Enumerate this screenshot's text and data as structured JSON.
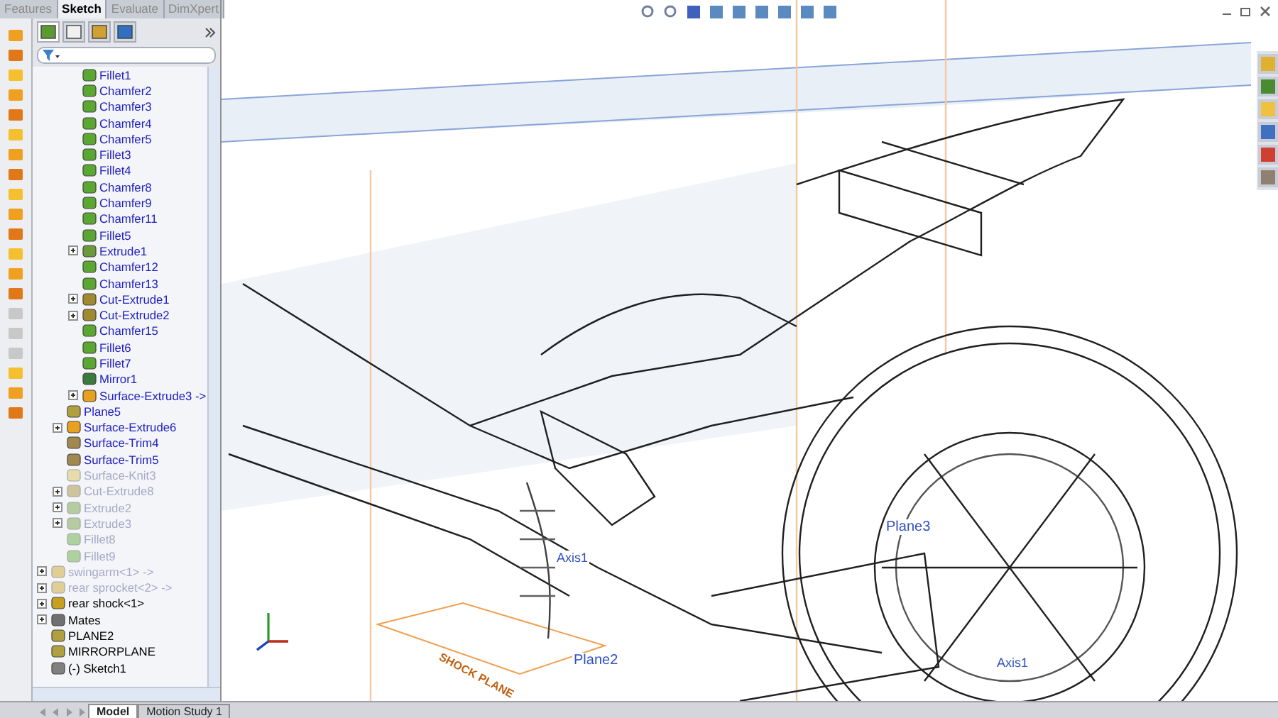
{
  "manager_tabs": [
    {
      "label": "Features",
      "selected": false
    },
    {
      "label": "Sketch",
      "selected": true
    },
    {
      "label": "Evaluate",
      "selected": false
    },
    {
      "label": "DimXpert",
      "selected": false
    }
  ],
  "command_icons": [
    {
      "disabled": false
    },
    {
      "disabled": false
    },
    {
      "disabled": false
    },
    {
      "disabled": false
    },
    {
      "disabled": false
    },
    {
      "disabled": false
    },
    {
      "disabled": false
    },
    {
      "disabled": false
    },
    {
      "disabled": false
    },
    {
      "disabled": false
    },
    {
      "disabled": false
    },
    {
      "disabled": false
    },
    {
      "disabled": false
    },
    {
      "disabled": false
    },
    {
      "disabled": true
    },
    {
      "disabled": true
    },
    {
      "disabled": true
    },
    {
      "disabled": false
    },
    {
      "disabled": false
    },
    {
      "disabled": false
    }
  ],
  "panel_tabs": [
    {
      "selected": true
    },
    {
      "selected": false
    },
    {
      "selected": false
    },
    {
      "selected": false
    }
  ],
  "tree": {
    "items": [
      {
        "children": [
          {
            "children": [
              {
                "label": "Fillet1",
                "kind": "fillet",
                "suppressed": false,
                "expandable": false
              },
              {
                "label": "Chamfer2",
                "kind": "fillet",
                "suppressed": false,
                "expandable": false
              },
              {
                "label": "Chamfer3",
                "kind": "fillet",
                "suppressed": false,
                "expandable": false
              },
              {
                "label": "Chamfer4",
                "kind": "fillet",
                "suppressed": false,
                "expandable": false
              },
              {
                "label": "Chamfer5",
                "kind": "fillet",
                "suppressed": false,
                "expandable": false
              },
              {
                "label": "Fillet3",
                "kind": "fillet",
                "suppressed": false,
                "expandable": false
              },
              {
                "label": "Fillet4",
                "kind": "fillet",
                "suppressed": false,
                "expandable": false
              },
              {
                "label": "Chamfer8",
                "kind": "fillet",
                "suppressed": false,
                "expandable": false
              },
              {
                "label": "Chamfer9",
                "kind": "fillet",
                "suppressed": false,
                "expandable": false
              },
              {
                "label": "Chamfer11",
                "kind": "fillet",
                "suppressed": false,
                "expandable": false
              },
              {
                "label": "Fillet5",
                "kind": "fillet",
                "suppressed": false,
                "expandable": false
              },
              {
                "label": "Extrude1",
                "kind": "extrude",
                "suppressed": false,
                "expandable": true
              },
              {
                "label": "Chamfer12",
                "kind": "fillet",
                "suppressed": false,
                "expandable": false
              },
              {
                "label": "Chamfer13",
                "kind": "fillet",
                "suppressed": false,
                "expandable": false
              },
              {
                "label": "Cut-Extrude1",
                "kind": "cut",
                "suppressed": false,
                "expandable": true
              },
              {
                "label": "Cut-Extrude2",
                "kind": "cut",
                "suppressed": false,
                "expandable": true
              },
              {
                "label": "Chamfer15",
                "kind": "fillet",
                "suppressed": false,
                "expandable": false
              },
              {
                "label": "Fillet6",
                "kind": "fillet",
                "suppressed": false,
                "expandable": false
              },
              {
                "label": "Fillet7",
                "kind": "fillet",
                "suppressed": false,
                "expandable": false
              },
              {
                "label": "Mirror1",
                "kind": "mirror",
                "suppressed": false,
                "expandable": false
              },
              {
                "label": "Surface-Extrude3 ->",
                "kind": "surface",
                "suppressed": false,
                "expandable": true
              }
            ]
          },
          {
            "label": "Plane5",
            "kind": "plane",
            "suppressed": false,
            "expandable": false
          },
          {
            "label": "Surface-Extrude6",
            "kind": "surface",
            "suppressed": false,
            "expandable": true
          },
          {
            "label": "Surface-Trim4",
            "kind": "trim",
            "suppressed": false,
            "expandable": false
          },
          {
            "label": "Surface-Trim5",
            "kind": "trim",
            "suppressed": false,
            "expandable": false
          },
          {
            "label": "Surface-Knit3",
            "kind": "knit",
            "suppressed": true,
            "expandable": false
          },
          {
            "label": "Cut-Extrude8",
            "kind": "cut",
            "suppressed": true,
            "expandable": true
          },
          {
            "label": "Extrude2",
            "kind": "extrude",
            "suppressed": true,
            "expandable": true
          },
          {
            "label": "Extrude3",
            "kind": "extrude",
            "suppressed": true,
            "expandable": true
          },
          {
            "label": "Fillet8",
            "kind": "fillet",
            "suppressed": true,
            "expandable": false
          },
          {
            "label": "Fillet9",
            "kind": "fillet",
            "suppressed": true,
            "expandable": false
          }
        ]
      },
      {
        "label": "swingarm<1> ->",
        "kind": "part",
        "suppressed": true,
        "expandable": true
      },
      {
        "label": "rear sprocket<2> ->",
        "kind": "part",
        "suppressed": true,
        "expandable": true
      },
      {
        "label": "rear shock<1>",
        "kind": "part",
        "suppressed": false,
        "expandable": true
      },
      {
        "label": "Mates",
        "kind": "mates",
        "suppressed": false,
        "expandable": true
      },
      {
        "label": "PLANE2",
        "kind": "plane",
        "suppressed": false,
        "expandable": false
      },
      {
        "label": "MIRRORPLANE",
        "kind": "plane",
        "suppressed": false,
        "expandable": false
      },
      {
        "label": "(-) Sketch1",
        "kind": "sketch",
        "suppressed": false,
        "expandable": false
      }
    ]
  },
  "bottom_tabs": [
    {
      "label": "Model",
      "selected": true
    },
    {
      "label": "Motion Study 1",
      "selected": false
    }
  ],
  "viewport": {
    "labels": [
      {
        "text": "Axis1",
        "kind": "axis"
      },
      {
        "text": "Plane3",
        "kind": "plane"
      },
      {
        "text": "Plane2",
        "kind": "plane"
      },
      {
        "text": "Axis1",
        "kind": "axis"
      },
      {
        "text": "SHOCK PLANE",
        "kind": "shock"
      }
    ]
  }
}
